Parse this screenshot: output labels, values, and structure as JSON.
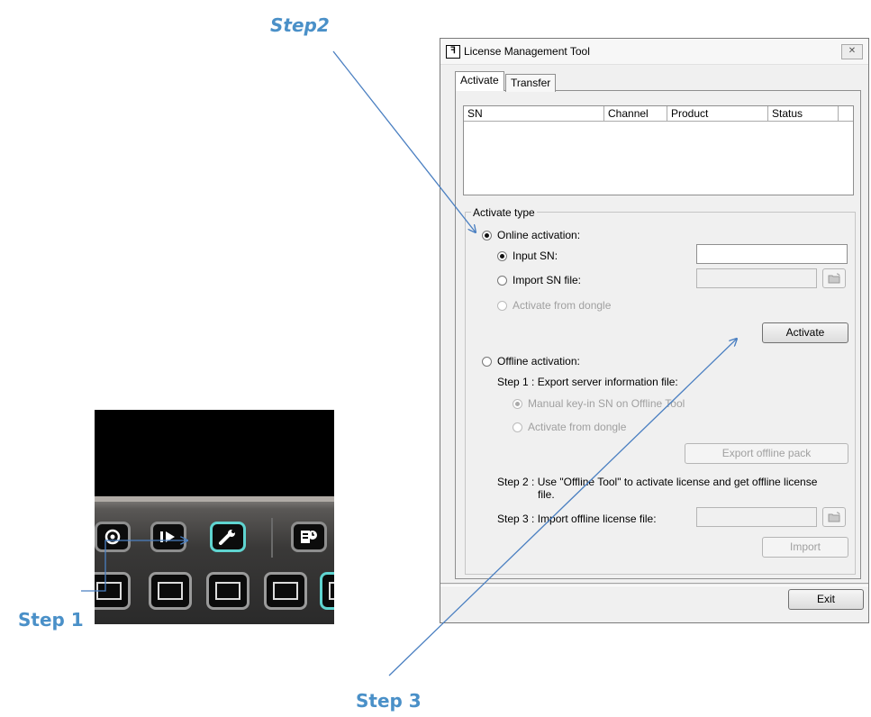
{
  "annotations": {
    "step1": "Step 1",
    "step2": "Step2",
    "step3": "Step 3",
    "color": "#4a7fc1"
  },
  "thumbnail": {
    "toolbar_icons": [
      "playback-icon",
      "play-forward-icon",
      "wrench-icon",
      "schedule-icon"
    ],
    "layout_icons": [
      "layout-1-icon",
      "layout-2-icon",
      "layout-3-icon",
      "layout-4-icon",
      "layout-5-icon"
    ],
    "accent": "#5fd4d0"
  },
  "dialog": {
    "title": "License Management Tool",
    "close_glyph": "✕",
    "tabs": [
      {
        "label": "Activate",
        "selected": true
      },
      {
        "label": "Transfer",
        "selected": false
      }
    ],
    "table": {
      "columns": [
        "SN",
        "Channel",
        "Product",
        "Status"
      ]
    },
    "activate_type": {
      "label": "Activate type",
      "online": {
        "label": "Online activation:",
        "input_sn": "Input SN:",
        "import_sn_file": "Import SN file:",
        "activate_from_dongle": "Activate from dongle",
        "activate_button": "Activate"
      },
      "offline": {
        "label": "Offline activation:",
        "step1": "Step 1 : Export server information file:",
        "manual_key_in": "Manual key-in SN on Offline Tool",
        "activate_from_dongle": "Activate from dongle",
        "export_button": "Export offline pack",
        "step2_line1": "Step 2 : Use \"Offline Tool\" to activate license and get offline license",
        "step2_line2": "file.",
        "step3": "Step 3 : Import offline license file:",
        "import_button": "Import"
      }
    },
    "exit_button": "Exit"
  }
}
